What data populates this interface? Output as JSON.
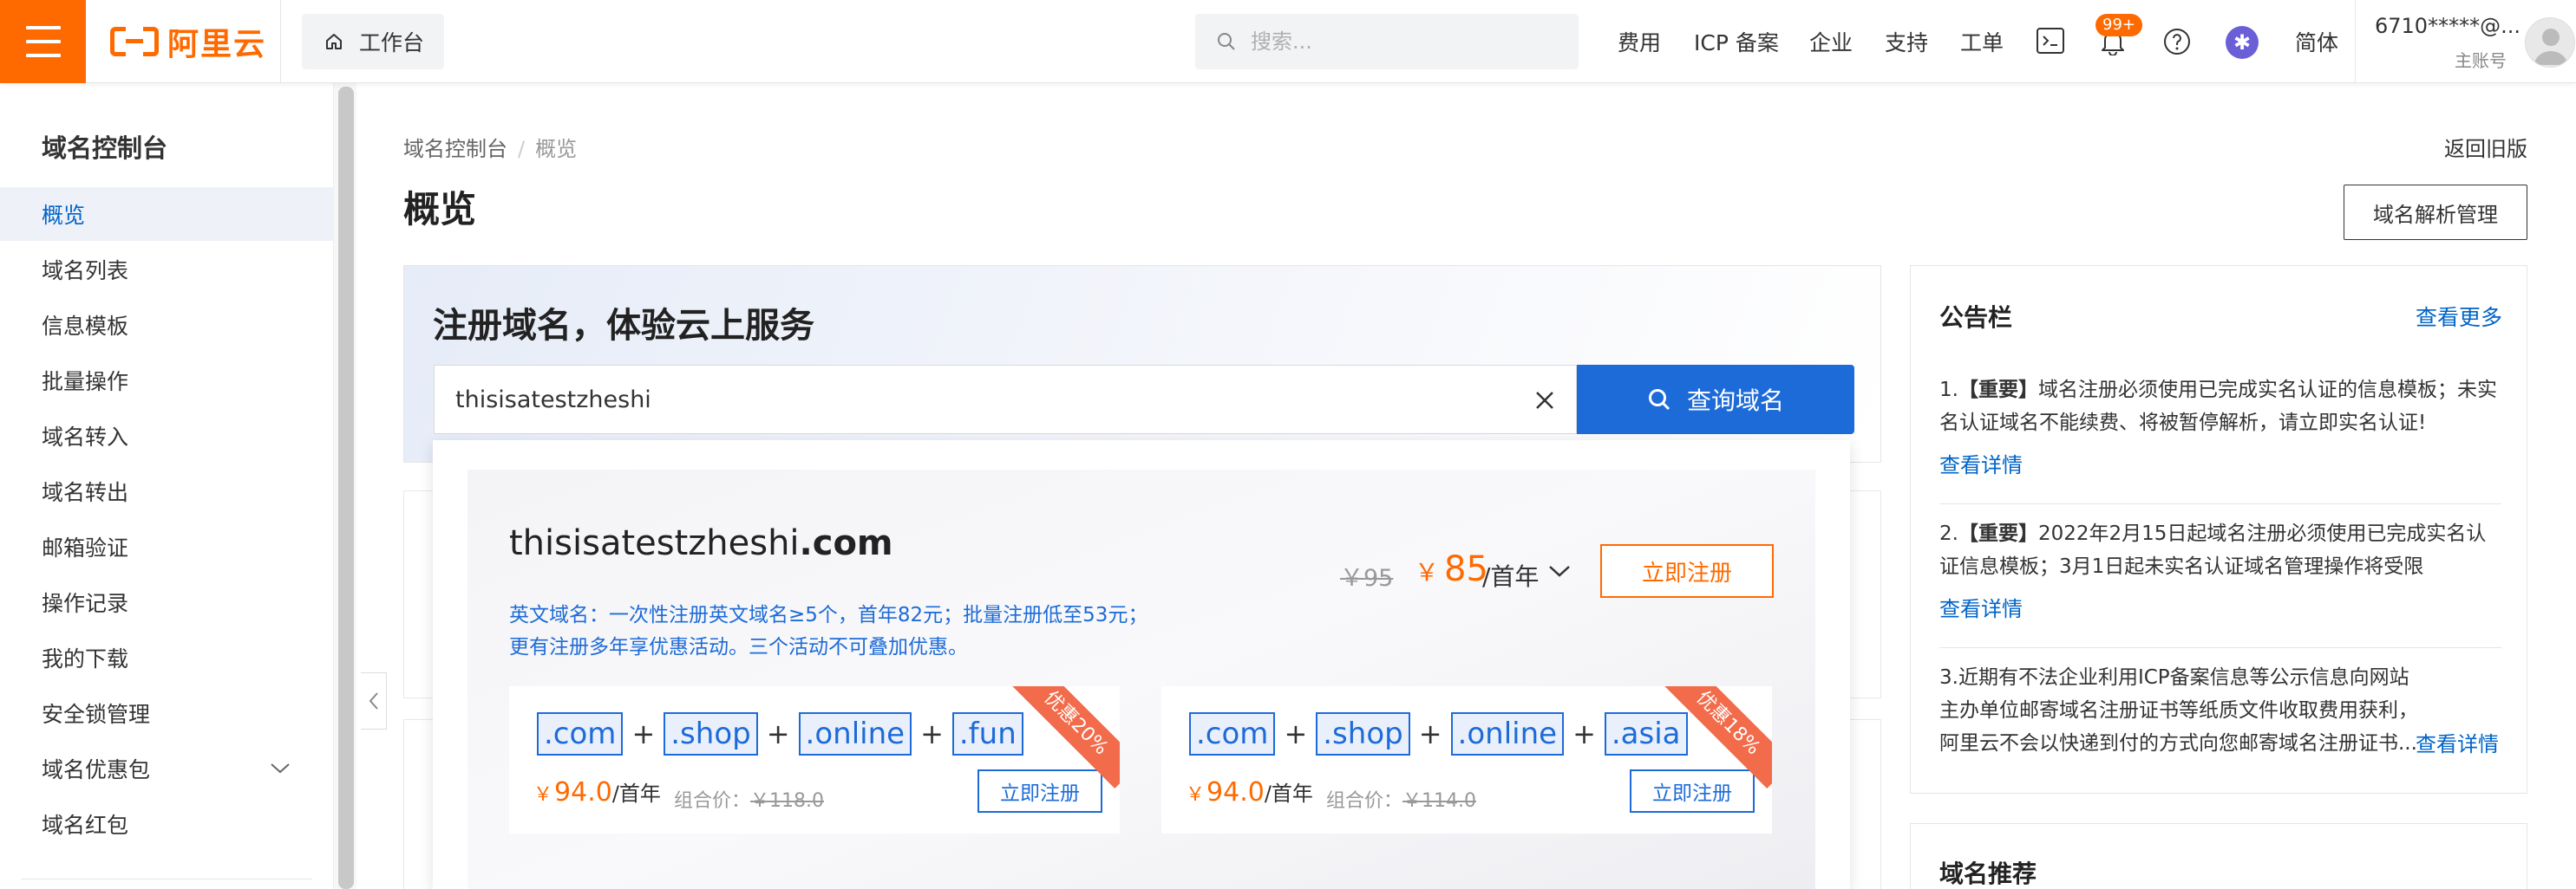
{
  "header": {
    "logo_text": "阿里云",
    "workbench_label": "工作台",
    "search_placeholder": "搜索...",
    "nav": [
      "费用",
      "ICP 备案",
      "企业",
      "支持",
      "工单"
    ],
    "notification_badge": "99+",
    "language": "简体",
    "account_name": "6710*****@...",
    "account_role": "主账号"
  },
  "sidebar": {
    "title": "域名控制台",
    "items": [
      {
        "label": "概览",
        "active": true
      },
      {
        "label": "域名列表"
      },
      {
        "label": "信息模板"
      },
      {
        "label": "批量操作"
      },
      {
        "label": "域名转入"
      },
      {
        "label": "域名转出"
      },
      {
        "label": "邮箱验证"
      },
      {
        "label": "操作记录"
      },
      {
        "label": "我的下载"
      },
      {
        "label": "安全锁管理"
      },
      {
        "label": "域名优惠包",
        "expandable": true
      },
      {
        "label": "域名红包"
      }
    ]
  },
  "main": {
    "breadcrumb": [
      "域名控制台",
      "概览"
    ],
    "back_old": "返回旧版",
    "title": "概览",
    "dns_button": "域名解析管理",
    "register": {
      "title": "注册域名，体验云上服务",
      "input_value": "thisisatestzheshi",
      "search_button": "查询域名"
    },
    "dropdown": {
      "domain_name": "thisisatestzheshi",
      "domain_tld": ".com",
      "old_price": "￥95",
      "price_symbol": "￥",
      "price": "85",
      "price_unit": "/首年",
      "register_button": "立即注册",
      "note": "英文域名：一次性注册英文域名≥5个，首年82元；批量注册低至53元；更有注册多年享优惠活动。三个活动不可叠加优惠。",
      "bundles": [
        {
          "tlds": [
            ".com",
            ".shop",
            ".online",
            ".fun"
          ],
          "price_symbol": "￥",
          "price": "94.0",
          "unit": "/首年",
          "combo_label": "组合价：",
          "combo_price": "￥118.0",
          "button": "立即注册",
          "ribbon": "优惠20%"
        },
        {
          "tlds": [
            ".com",
            ".shop",
            ".online",
            ".asia"
          ],
          "price_symbol": "￥",
          "price": "94.0",
          "unit": "/首年",
          "combo_label": "组合价：",
          "combo_price": "￥114.0",
          "button": "立即注册",
          "ribbon": "优惠18%"
        }
      ]
    }
  },
  "notice": {
    "title": "公告栏",
    "more": "查看更多",
    "items": [
      {
        "num": "1.",
        "tag": "【重要】",
        "text": "域名注册必须使用已完成实名认证的信息模板；未实名认证域名不能续费、将被暂停解析，请立即实名认证!",
        "link": "查看详情"
      },
      {
        "num": "2.",
        "tag": "【重要】",
        "text": "2022年2月15日起域名注册必须使用已完成实名认证信息模板；3月1日起未实名认证域名管理操作将受限",
        "link": "查看详情"
      },
      {
        "num": "3.",
        "tag": "",
        "text": "近期有不法企业利用ICP备案信息等公示信息向网站主办单位邮寄域名注册证书等纸质文件收取费用获利，阿里云不会以快递到付的方式向您邮寄域名注册证书...",
        "link": "查看详情"
      }
    ]
  },
  "recommend": {
    "title": "域名推荐"
  },
  "colors": {
    "brand": "#ff6a00",
    "primary": "#1d6bd8",
    "link": "#0064c8"
  }
}
